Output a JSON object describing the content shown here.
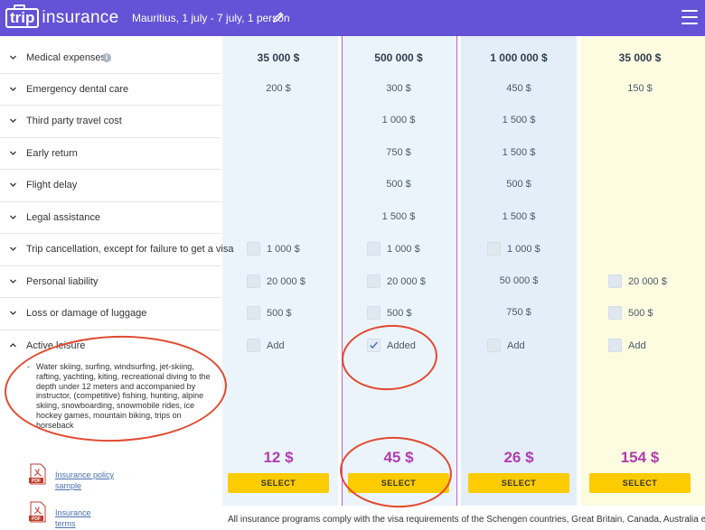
{
  "header": {
    "logo_trip": "trip",
    "logo_insurance": "insurance",
    "search_summary": "Mauritius, 1 july - 7 july, 1 person",
    "edit_icon": "pencil-icon",
    "menu_icon": "hamburger-menu-icon",
    "background": "#6552d6"
  },
  "rows": [
    {
      "label": "Medical expenses",
      "info_icon": true
    },
    {
      "label": "Emergency dental care"
    },
    {
      "label": "Third party travel cost"
    },
    {
      "label": "Early return"
    },
    {
      "label": "Flight delay"
    },
    {
      "label": "Legal assistance"
    },
    {
      "label": "Trip cancellation, except for failure to get a visa"
    },
    {
      "label": "Personal liability"
    },
    {
      "label": "Loss or damage of luggage"
    },
    {
      "label": "Active leisure",
      "expanded": true
    }
  ],
  "active_leisure_description": "Water skiing, surfing, windsurfing, jet-skiing, rafting, yachting, kiting, recreational diving to the depth under 12 meters and accompanied by instructor, (competitive) fishing, hunting, alpine skiing, snowboarding, snowmobile rides, ice hockey games, mountain biking, trips on horseback",
  "active_leisure_dash": "-",
  "plans": [
    {
      "bg": "#ecf4fb",
      "medical": "35 000 $",
      "dental": "200 $",
      "third_party": "",
      "early_return": "",
      "flight_delay": "",
      "legal": "",
      "cancellation": "1 000 $",
      "liability": "20 000 $",
      "luggage": "500 $",
      "leisure": "Add",
      "price": "12 $",
      "select": "SELECT"
    },
    {
      "bg": "#ecf4fb",
      "medical": "500 000 $",
      "dental": "300 $",
      "third_party": "1 000 $",
      "early_return": "750 $",
      "flight_delay": "500 $",
      "legal": "1 500 $",
      "cancellation": "1 000 $",
      "liability": "20 000 $",
      "luggage": "500 $",
      "leisure": "Added",
      "price": "45 $",
      "select": "SELECT"
    },
    {
      "bg": "#e3eef9",
      "medical": "1 000 000 $",
      "dental": "450 $",
      "third_party": "1 500 $",
      "early_return": "1 500 $",
      "flight_delay": "500 $",
      "legal": "1 500 $",
      "cancellation": "1 000 $",
      "liability": "50 000 $",
      "luggage": "750 $",
      "leisure": "Add",
      "price": "26 $",
      "select": "SELECT"
    },
    {
      "bg": "#fdfbe0",
      "medical": "35 000 $",
      "dental": "150 $",
      "third_party": "",
      "early_return": "",
      "flight_delay": "",
      "legal": "",
      "cancellation": "",
      "liability": "20 000 $",
      "luggage": "500 $",
      "leisure": "Add",
      "price": "154 $",
      "select": "SELECT"
    }
  ],
  "documents": [
    {
      "label": "Insurance policy sample",
      "icon": "pdf-icon"
    },
    {
      "label": "Insurance terms",
      "icon": "pdf-icon"
    }
  ],
  "pdf_badge": "PDF",
  "footer_note": "All insurance programs comply with the visa requirements of the Schengen countries, Great Britain, Canada, Australia etc.",
  "colors": {
    "accent": "#6552d6",
    "price": "#b03db0",
    "button": "#fccb00",
    "annotation": "#e2492e"
  }
}
